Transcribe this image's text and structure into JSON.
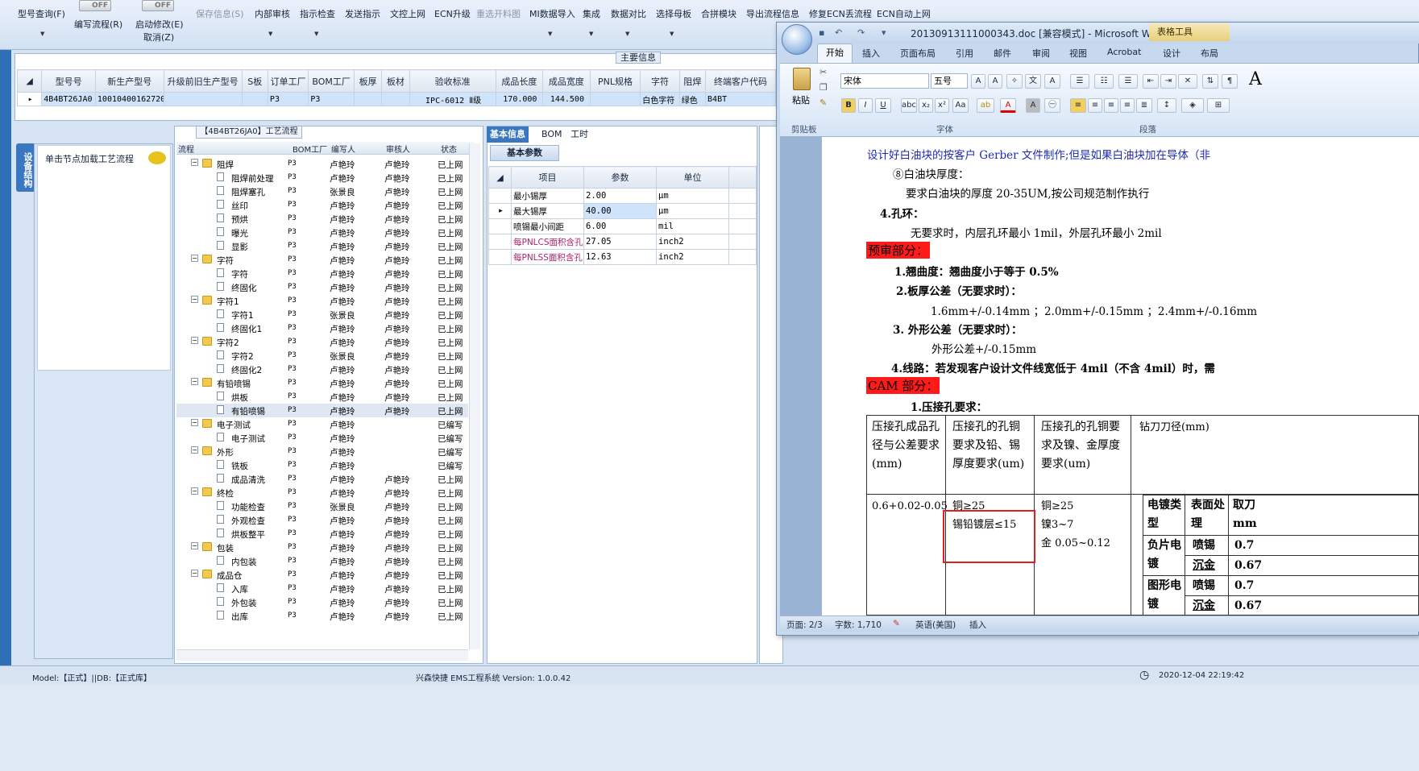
{
  "toolbar": {
    "items": [
      "型号查询(F)",
      "编写流程(R)",
      "启动修改(E)",
      "取消(Z)",
      "保存信息(S)",
      "内部审核",
      "指示检查",
      "发送指示",
      "文控上网",
      "ECN升级",
      "重选开料图",
      "MI数据导入",
      "集成",
      "数据对比",
      "选择母板",
      "合拼模块",
      "导出流程信息",
      "修复ECN丢流程",
      "ECN自动上网"
    ],
    "toggle_off": "OFF"
  },
  "main_info": {
    "title": "主要信息",
    "columns": [
      "型号号",
      "新生产型号",
      "升级前旧生产型号",
      "S板",
      "订单工厂",
      "BOM工厂",
      "板厚",
      "板材",
      "验收标准",
      "成品长度",
      "成品宽度",
      "PNL规格",
      "字符",
      "阻焊",
      "终端客户代码"
    ],
    "row": [
      "4B4BT26JA0",
      "10010400162720",
      "",
      "",
      "P3",
      "P3",
      "",
      "",
      "IPC-6012 Ⅱ级",
      "170.000",
      "144.500",
      "",
      "白色字符",
      "绿色",
      "B4BT"
    ]
  },
  "nav": {
    "tab_label": "设备结构",
    "item": "单击节点加载工艺流程"
  },
  "process": {
    "title": "【4B4BT26JA0】工艺流程",
    "columns": [
      "流程",
      "BOM工厂",
      "编写人",
      "审核人",
      "状态"
    ],
    "rows": [
      {
        "level": 0,
        "type": "folder",
        "name": "阻焊",
        "bom": "P3",
        "writer": "卢艳玲",
        "reviewer": "卢艳玲",
        "status": "已上网"
      },
      {
        "level": 1,
        "type": "doc",
        "name": "阻焊前处理",
        "bom": "P3",
        "writer": "卢艳玲",
        "reviewer": "卢艳玲",
        "status": "已上网"
      },
      {
        "level": 1,
        "type": "doc",
        "name": "阻焊塞孔",
        "bom": "P3",
        "writer": "张景良",
        "reviewer": "卢艳玲",
        "status": "已上网"
      },
      {
        "level": 1,
        "type": "doc",
        "name": "丝印",
        "bom": "P3",
        "writer": "卢艳玲",
        "reviewer": "卢艳玲",
        "status": "已上网"
      },
      {
        "level": 1,
        "type": "doc",
        "name": "预烘",
        "bom": "P3",
        "writer": "卢艳玲",
        "reviewer": "卢艳玲",
        "status": "已上网"
      },
      {
        "level": 1,
        "type": "doc",
        "name": "曝光",
        "bom": "P3",
        "writer": "卢艳玲",
        "reviewer": "卢艳玲",
        "status": "已上网"
      },
      {
        "level": 1,
        "type": "doc",
        "name": "显影",
        "bom": "P3",
        "writer": "卢艳玲",
        "reviewer": "卢艳玲",
        "status": "已上网"
      },
      {
        "level": 0,
        "type": "folder",
        "name": "字符",
        "bom": "P3",
        "writer": "卢艳玲",
        "reviewer": "卢艳玲",
        "status": "已上网"
      },
      {
        "level": 1,
        "type": "doc",
        "name": "字符",
        "bom": "P3",
        "writer": "卢艳玲",
        "reviewer": "卢艳玲",
        "status": "已上网"
      },
      {
        "level": 1,
        "type": "doc",
        "name": "终固化",
        "bom": "P3",
        "writer": "卢艳玲",
        "reviewer": "卢艳玲",
        "status": "已上网"
      },
      {
        "level": 0,
        "type": "folder",
        "name": "字符1",
        "bom": "P3",
        "writer": "卢艳玲",
        "reviewer": "卢艳玲",
        "status": "已上网"
      },
      {
        "level": 1,
        "type": "doc",
        "name": "字符1",
        "bom": "P3",
        "writer": "张景良",
        "reviewer": "卢艳玲",
        "status": "已上网"
      },
      {
        "level": 1,
        "type": "doc",
        "name": "终固化1",
        "bom": "P3",
        "writer": "卢艳玲",
        "reviewer": "卢艳玲",
        "status": "已上网"
      },
      {
        "level": 0,
        "type": "folder",
        "name": "字符2",
        "bom": "P3",
        "writer": "卢艳玲",
        "reviewer": "卢艳玲",
        "status": "已上网"
      },
      {
        "level": 1,
        "type": "doc",
        "name": "字符2",
        "bom": "P3",
        "writer": "张景良",
        "reviewer": "卢艳玲",
        "status": "已上网"
      },
      {
        "level": 1,
        "type": "doc",
        "name": "终固化2",
        "bom": "P3",
        "writer": "卢艳玲",
        "reviewer": "卢艳玲",
        "status": "已上网"
      },
      {
        "level": 0,
        "type": "folder",
        "name": "有铅喷锡",
        "bom": "P3",
        "writer": "卢艳玲",
        "reviewer": "卢艳玲",
        "status": "已上网"
      },
      {
        "level": 1,
        "type": "doc",
        "name": "烘板",
        "bom": "P3",
        "writer": "卢艳玲",
        "reviewer": "卢艳玲",
        "status": "已上网"
      },
      {
        "level": 1,
        "type": "doc",
        "name": "有铅喷锡",
        "bom": "P3",
        "writer": "卢艳玲",
        "reviewer": "卢艳玲",
        "status": "已上网"
      },
      {
        "level": 0,
        "type": "folder",
        "name": "电子测试",
        "bom": "P3",
        "writer": "卢艳玲",
        "reviewer": "",
        "status": "已编写"
      },
      {
        "level": 1,
        "type": "doc",
        "name": "电子测试",
        "bom": "P3",
        "writer": "卢艳玲",
        "reviewer": "",
        "status": "已编写"
      },
      {
        "level": 0,
        "type": "folder",
        "name": "外形",
        "bom": "P3",
        "writer": "卢艳玲",
        "reviewer": "",
        "status": "已编写"
      },
      {
        "level": 1,
        "type": "doc",
        "name": "铣板",
        "bom": "P3",
        "writer": "卢艳玲",
        "reviewer": "",
        "status": "已编写"
      },
      {
        "level": 1,
        "type": "doc",
        "name": "成品清洗",
        "bom": "P3",
        "writer": "卢艳玲",
        "reviewer": "卢艳玲",
        "status": "已上网"
      },
      {
        "level": 0,
        "type": "folder",
        "name": "终检",
        "bom": "P3",
        "writer": "卢艳玲",
        "reviewer": "卢艳玲",
        "status": "已上网"
      },
      {
        "level": 1,
        "type": "doc",
        "name": "功能检查",
        "bom": "P3",
        "writer": "张景良",
        "reviewer": "卢艳玲",
        "status": "已上网"
      },
      {
        "level": 1,
        "type": "doc",
        "name": "外观检查",
        "bom": "P3",
        "writer": "卢艳玲",
        "reviewer": "卢艳玲",
        "status": "已上网"
      },
      {
        "level": 1,
        "type": "doc",
        "name": "烘板整平",
        "bom": "P3",
        "writer": "卢艳玲",
        "reviewer": "卢艳玲",
        "status": "已上网"
      },
      {
        "level": 0,
        "type": "folder",
        "name": "包装",
        "bom": "P3",
        "writer": "卢艳玲",
        "reviewer": "卢艳玲",
        "status": "已上网"
      },
      {
        "level": 1,
        "type": "doc",
        "name": "内包装",
        "bom": "P3",
        "writer": "卢艳玲",
        "reviewer": "卢艳玲",
        "status": "已上网"
      },
      {
        "level": 0,
        "type": "folder",
        "name": "成品仓",
        "bom": "P3",
        "writer": "卢艳玲",
        "reviewer": "卢艳玲",
        "status": "已上网"
      },
      {
        "level": 1,
        "type": "doc",
        "name": "入库",
        "bom": "P3",
        "writer": "卢艳玲",
        "reviewer": "卢艳玲",
        "status": "已上网"
      },
      {
        "level": 1,
        "type": "doc",
        "name": "外包装",
        "bom": "P3",
        "writer": "卢艳玲",
        "reviewer": "卢艳玲",
        "status": "已上网"
      },
      {
        "level": 1,
        "type": "doc",
        "name": "出库",
        "bom": "P3",
        "writer": "卢艳玲",
        "reviewer": "卢艳玲",
        "status": "已上网"
      }
    ]
  },
  "info": {
    "tabs": [
      "基本信息",
      "BOM",
      "工时"
    ],
    "subtab": "基本参数",
    "columns": [
      "项目",
      "参数",
      "单位"
    ],
    "rows": [
      {
        "item": "最小锡厚",
        "value": "2.00",
        "unit": "μm",
        "pink": false
      },
      {
        "item": "最大锡厚",
        "value": "40.00",
        "unit": "μm",
        "pink": false
      },
      {
        "item": "喷锡最小间距",
        "value": "6.00",
        "unit": "mil",
        "pink": false
      },
      {
        "item": "每PNLCS面积含孔",
        "value": "27.05",
        "unit": "inch2",
        "pink": true
      },
      {
        "item": "每PNLSS面积含孔",
        "value": "12.63",
        "unit": "inch2",
        "pink": true
      }
    ]
  },
  "status": {
    "model": "Model:【正式】||DB:【正式库】",
    "app": "兴森快捷 EMS工程系统 Version: 1.0.0.42",
    "datetime": "2020-12-04 22:19:42"
  },
  "word": {
    "title": "20130913111000343.doc [兼容模式] - Microsoft Wo...",
    "table_tools": "表格工具",
    "tabs": [
      "开始",
      "插入",
      "页面布局",
      "引用",
      "邮件",
      "审阅",
      "视图",
      "Acrobat",
      "设计",
      "布局"
    ],
    "paste": "粘贴",
    "font_name": "宋体",
    "font_size": "五号",
    "groups": [
      "剪贴板",
      "字体",
      "段落"
    ],
    "lines": [
      "设计好白油块的按客户 Gerber 文件制作;但是如果白油块加在导体（非",
      "⑧白油块厚度：",
      "要求白油块的厚度 20-35UM,按公司规范制作执行",
      "4.孔环：",
      "无要求时，内层孔环最小 1mil，外层孔环最小 2mil",
      "预审部分：",
      "1.翘曲度：翘曲度小于等于 0.5%",
      "2.板厚公差（无要求时）：",
      "1.6mm+/-0.14mm  ；2.0mm+/-0.15mm  ；2.4mm+/-0.16mm",
      "3. 外形公差（无要求时）：",
      "外形公差+/-0.15mm",
      "4.线路：若发现客户设计文件线宽低于 4mil（不含 4mil）时，需",
      "CAM 部分：",
      "1.压接孔要求："
    ],
    "table": {
      "h1": "压接孔成品孔径与公差要求(mm)",
      "h2": "压接孔的孔铜要求及铅、锡厚度要求(um)",
      "h3": "压接孔的孔铜要求及镍、金厚度要求(um)",
      "h4": "钻刀刀径(mm)",
      "c1": "0.6+0.02-0.05",
      "c2a": "铜≥25",
      "c2b": "锡铅镀层≤15",
      "c3a": "铜≥25",
      "c3b": "镍3~7",
      "c3c": "金 0.05~0.12",
      "sub_h1": "电镀类型",
      "sub_h2": "表面处理",
      "sub_h3": "取刀mm",
      "sub_r1a": "负片电镀",
      "sub_r1b": "喷锡",
      "sub_r1c": "沉金",
      "sub_r1d": "0.7",
      "sub_r1e": "0.67",
      "sub_r2a": "图形电镀",
      "sub_r2b": "喷锡",
      "sub_r2c": "沉金",
      "sub_r2d": "0.7",
      "sub_r2e": "0.67"
    },
    "status": {
      "page": "页面: 2/3",
      "words": "字数: 1,710",
      "lang": "英语(美国)",
      "mode": "插入"
    }
  }
}
